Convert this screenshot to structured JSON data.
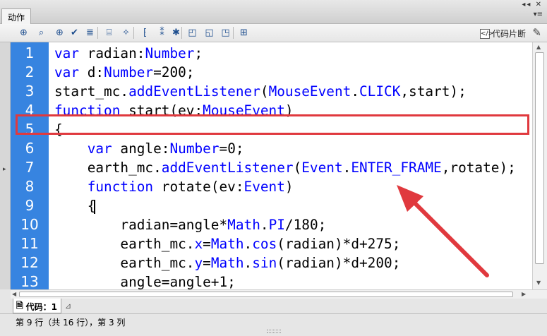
{
  "panel": {
    "tab_label": "动作",
    "window_controls": "◂◂ ✕",
    "menu_icon": "menu-icon"
  },
  "toolbar": {
    "buttons": [
      {
        "name": "add-item-icon",
        "glyph": "⊕"
      },
      {
        "name": "find-icon",
        "glyph": "⌕"
      },
      {
        "name": "target-icon",
        "glyph": "⊕"
      },
      {
        "name": "check-syntax-icon",
        "glyph": "✔"
      },
      {
        "name": "auto-format-icon",
        "glyph": "≣"
      },
      {
        "name": "code-hint-icon",
        "glyph": "⌸"
      },
      {
        "name": "debug-options-icon",
        "glyph": "✧"
      },
      {
        "name": "collapse-between-braces-icon",
        "glyph": "⁅"
      },
      {
        "name": "collapse-selection-icon",
        "glyph": "⁑"
      },
      {
        "name": "expand-all-icon",
        "glyph": "✱"
      },
      {
        "name": "apply-block-comment-icon",
        "glyph": "◰"
      },
      {
        "name": "apply-line-comment-icon",
        "glyph": "◱"
      },
      {
        "name": "remove-comment-icon",
        "glyph": "◳"
      },
      {
        "name": "show-hide-toolbox-icon",
        "glyph": "⊞"
      }
    ],
    "code_snippets_label": "代码片断",
    "snippets_icon": "code-snippets-icon",
    "wand_icon": "magic-wand-icon"
  },
  "editor": {
    "lines": [
      {
        "num": "1",
        "tokens": [
          {
            "t": "var",
            "c": "kw"
          },
          {
            "t": " radian:",
            "c": ""
          },
          {
            "t": "Number",
            "c": "tp"
          },
          {
            "t": ";",
            "c": ""
          }
        ]
      },
      {
        "num": "2",
        "tokens": [
          {
            "t": "var",
            "c": "kw"
          },
          {
            "t": " d:",
            "c": ""
          },
          {
            "t": "Number",
            "c": "tp"
          },
          {
            "t": "=200;",
            "c": ""
          }
        ]
      },
      {
        "num": "3",
        "tokens": [
          {
            "t": "start_mc.",
            "c": ""
          },
          {
            "t": "addEventListener",
            "c": "kw"
          },
          {
            "t": "(",
            "c": ""
          },
          {
            "t": "MouseEvent",
            "c": "tp"
          },
          {
            "t": ".",
            "c": ""
          },
          {
            "t": "CLICK",
            "c": "kw"
          },
          {
            "t": ",start);",
            "c": ""
          }
        ]
      },
      {
        "num": "4",
        "tokens": [
          {
            "t": "function",
            "c": "kw"
          },
          {
            "t": " start(ev:",
            "c": ""
          },
          {
            "t": "MouseEvent",
            "c": "tp"
          },
          {
            "t": ")",
            "c": ""
          }
        ]
      },
      {
        "num": "5",
        "tokens": [
          {
            "t": "{",
            "c": ""
          }
        ]
      },
      {
        "num": "6",
        "tokens": [
          {
            "t": "    ",
            "c": ""
          },
          {
            "t": "var",
            "c": "kw"
          },
          {
            "t": " angle:",
            "c": ""
          },
          {
            "t": "Number",
            "c": "tp"
          },
          {
            "t": "=0;",
            "c": ""
          }
        ]
      },
      {
        "num": "7",
        "tokens": [
          {
            "t": "    earth_mc.",
            "c": ""
          },
          {
            "t": "addEventListener",
            "c": "kw"
          },
          {
            "t": "(",
            "c": ""
          },
          {
            "t": "Event",
            "c": "tp"
          },
          {
            "t": ".",
            "c": ""
          },
          {
            "t": "ENTER_FRAME",
            "c": "kw"
          },
          {
            "t": ",rotate);",
            "c": ""
          }
        ]
      },
      {
        "num": "8",
        "tokens": [
          {
            "t": "    ",
            "c": ""
          },
          {
            "t": "function",
            "c": "kw"
          },
          {
            "t": " rotate(ev:",
            "c": ""
          },
          {
            "t": "Event",
            "c": "tp"
          },
          {
            "t": ")",
            "c": ""
          }
        ]
      },
      {
        "num": "9",
        "tokens": [
          {
            "t": "    {",
            "c": ""
          }
        ]
      },
      {
        "num": "10",
        "tokens": [
          {
            "t": "        radian=angle*",
            "c": ""
          },
          {
            "t": "Math",
            "c": "tp"
          },
          {
            "t": ".",
            "c": ""
          },
          {
            "t": "PI",
            "c": "kw"
          },
          {
            "t": "/180;",
            "c": ""
          }
        ]
      },
      {
        "num": "11",
        "tokens": [
          {
            "t": "        earth_mc.",
            "c": ""
          },
          {
            "t": "x",
            "c": "kw"
          },
          {
            "t": "=",
            "c": ""
          },
          {
            "t": "Math",
            "c": "tp"
          },
          {
            "t": ".",
            "c": ""
          },
          {
            "t": "cos",
            "c": "kw"
          },
          {
            "t": "(radian)*d+275;",
            "c": ""
          }
        ]
      },
      {
        "num": "12",
        "tokens": [
          {
            "t": "        earth_mc.",
            "c": ""
          },
          {
            "t": "y",
            "c": "kw"
          },
          {
            "t": "=",
            "c": ""
          },
          {
            "t": "Math",
            "c": "tp"
          },
          {
            "t": ".",
            "c": ""
          },
          {
            "t": "sin",
            "c": "kw"
          },
          {
            "t": "(radian)*d+200;",
            "c": ""
          }
        ]
      },
      {
        "num": "13",
        "tokens": [
          {
            "t": "        angle=angle+1;",
            "c": ""
          }
        ]
      }
    ],
    "highlighted_line": "7",
    "annotation_color": "#e0393e",
    "gutter_color": "#3784e0",
    "keyword_color": "#0000ff"
  },
  "bottom": {
    "code_tab_label": "代码：1",
    "code_tab_icon": "document-icon",
    "pin_icon": "pin-icon",
    "status_text": "第 9 行（共 16 行），第 3 列"
  }
}
